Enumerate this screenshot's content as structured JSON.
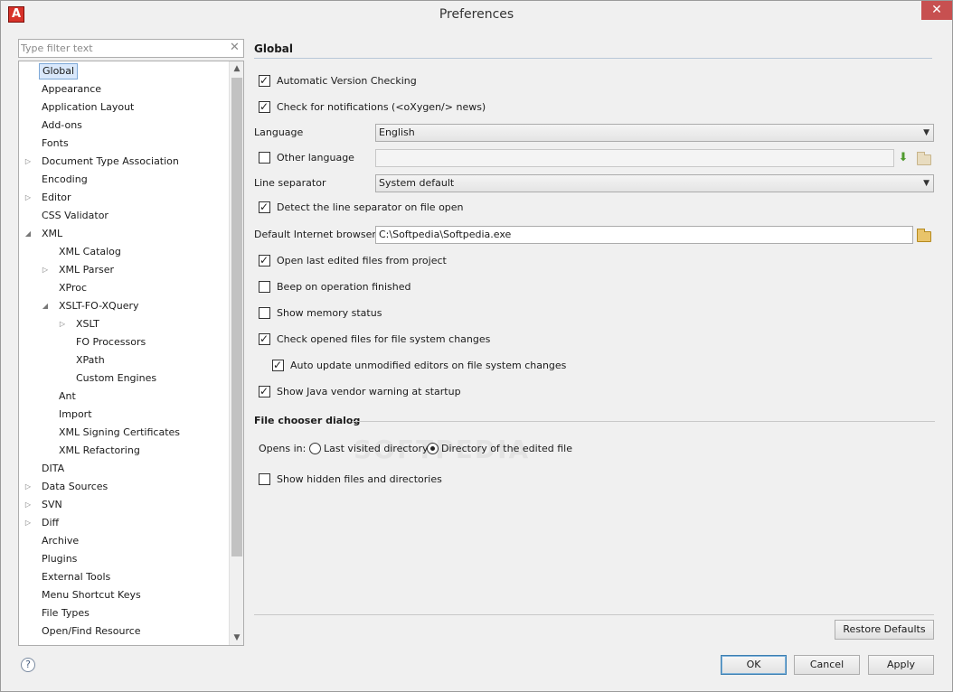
{
  "window": {
    "title": "Preferences",
    "close_symbol": "✕"
  },
  "filter": {
    "placeholder": "Type filter text"
  },
  "tree": {
    "items": [
      {
        "label": "Global",
        "level": 0,
        "expander": "none",
        "selected": true
      },
      {
        "label": "Appearance",
        "level": 0,
        "expander": "none"
      },
      {
        "label": "Application Layout",
        "level": 0,
        "expander": "none"
      },
      {
        "label": "Add-ons",
        "level": 0,
        "expander": "none"
      },
      {
        "label": "Fonts",
        "level": 0,
        "expander": "none"
      },
      {
        "label": "Document Type Association",
        "level": 0,
        "expander": "collapsed"
      },
      {
        "label": "Encoding",
        "level": 0,
        "expander": "none"
      },
      {
        "label": "Editor",
        "level": 0,
        "expander": "collapsed"
      },
      {
        "label": "CSS Validator",
        "level": 0,
        "expander": "none"
      },
      {
        "label": "XML",
        "level": 0,
        "expander": "expanded"
      },
      {
        "label": "XML Catalog",
        "level": 1,
        "expander": "none"
      },
      {
        "label": "XML Parser",
        "level": 1,
        "expander": "collapsed"
      },
      {
        "label": "XProc",
        "level": 1,
        "expander": "none"
      },
      {
        "label": "XSLT-FO-XQuery",
        "level": 1,
        "expander": "expanded"
      },
      {
        "label": "XSLT",
        "level": 2,
        "expander": "collapsed"
      },
      {
        "label": "FO Processors",
        "level": 2,
        "expander": "none"
      },
      {
        "label": "XPath",
        "level": 2,
        "expander": "none"
      },
      {
        "label": "Custom Engines",
        "level": 2,
        "expander": "none"
      },
      {
        "label": "Ant",
        "level": 1,
        "expander": "none"
      },
      {
        "label": "Import",
        "level": 1,
        "expander": "none"
      },
      {
        "label": "XML Signing Certificates",
        "level": 1,
        "expander": "none"
      },
      {
        "label": "XML Refactoring",
        "level": 1,
        "expander": "none"
      },
      {
        "label": "DITA",
        "level": 0,
        "expander": "none"
      },
      {
        "label": "Data Sources",
        "level": 0,
        "expander": "collapsed"
      },
      {
        "label": "SVN",
        "level": 0,
        "expander": "collapsed"
      },
      {
        "label": "Diff",
        "level": 0,
        "expander": "collapsed"
      },
      {
        "label": "Archive",
        "level": 0,
        "expander": "none"
      },
      {
        "label": "Plugins",
        "level": 0,
        "expander": "none"
      },
      {
        "label": "External Tools",
        "level": 0,
        "expander": "none"
      },
      {
        "label": "Menu Shortcut Keys",
        "level": 0,
        "expander": "none"
      },
      {
        "label": "File Types",
        "level": 0,
        "expander": "none"
      },
      {
        "label": "Open/Find Resource",
        "level": 0,
        "expander": "none"
      }
    ]
  },
  "global": {
    "title": "Global",
    "auto_version_check": {
      "label": "Automatic Version Checking",
      "checked": true
    },
    "check_notifications": {
      "label": "Check for notifications (<oXygen/> news)",
      "checked": true
    },
    "language": {
      "label": "Language",
      "value": "English"
    },
    "other_language": {
      "label": "Other language",
      "checked": false,
      "value": ""
    },
    "line_separator": {
      "label": "Line separator",
      "value": "System default"
    },
    "detect_line_separator": {
      "label": "Detect the line separator on file open",
      "checked": true
    },
    "default_browser": {
      "label": "Default Internet browser",
      "value": "C:\\Softpedia\\Softpedia.exe"
    },
    "open_last_edited": {
      "label": "Open last edited files from project",
      "checked": true
    },
    "beep_on_finish": {
      "label": "Beep on operation finished",
      "checked": false
    },
    "show_memory": {
      "label": "Show memory status",
      "checked": false
    },
    "check_fs_changes": {
      "label": "Check opened files for file system changes",
      "checked": true
    },
    "auto_update_editors": {
      "label": "Auto update unmodified editors on file system changes",
      "checked": true
    },
    "java_vendor_warning": {
      "label": "Show Java vendor warning at startup",
      "checked": true
    }
  },
  "file_chooser": {
    "title": "File chooser dialog",
    "opens_in_label": "Opens in:",
    "option_last_visited": {
      "label": "Last visited directory",
      "selected": false
    },
    "option_edited_file": {
      "label": "Directory of the edited file",
      "selected": true
    },
    "show_hidden": {
      "label": "Show hidden files and directories",
      "checked": false
    }
  },
  "buttons": {
    "restore_defaults": "Restore Defaults",
    "ok": "OK",
    "cancel": "Cancel",
    "apply": "Apply",
    "help": "?"
  },
  "watermark": "SOFTPEDIA",
  "colors": {
    "selection_bg": "#d9e8fb",
    "close_button": "#c75050",
    "app_icon": "#d8322a"
  }
}
